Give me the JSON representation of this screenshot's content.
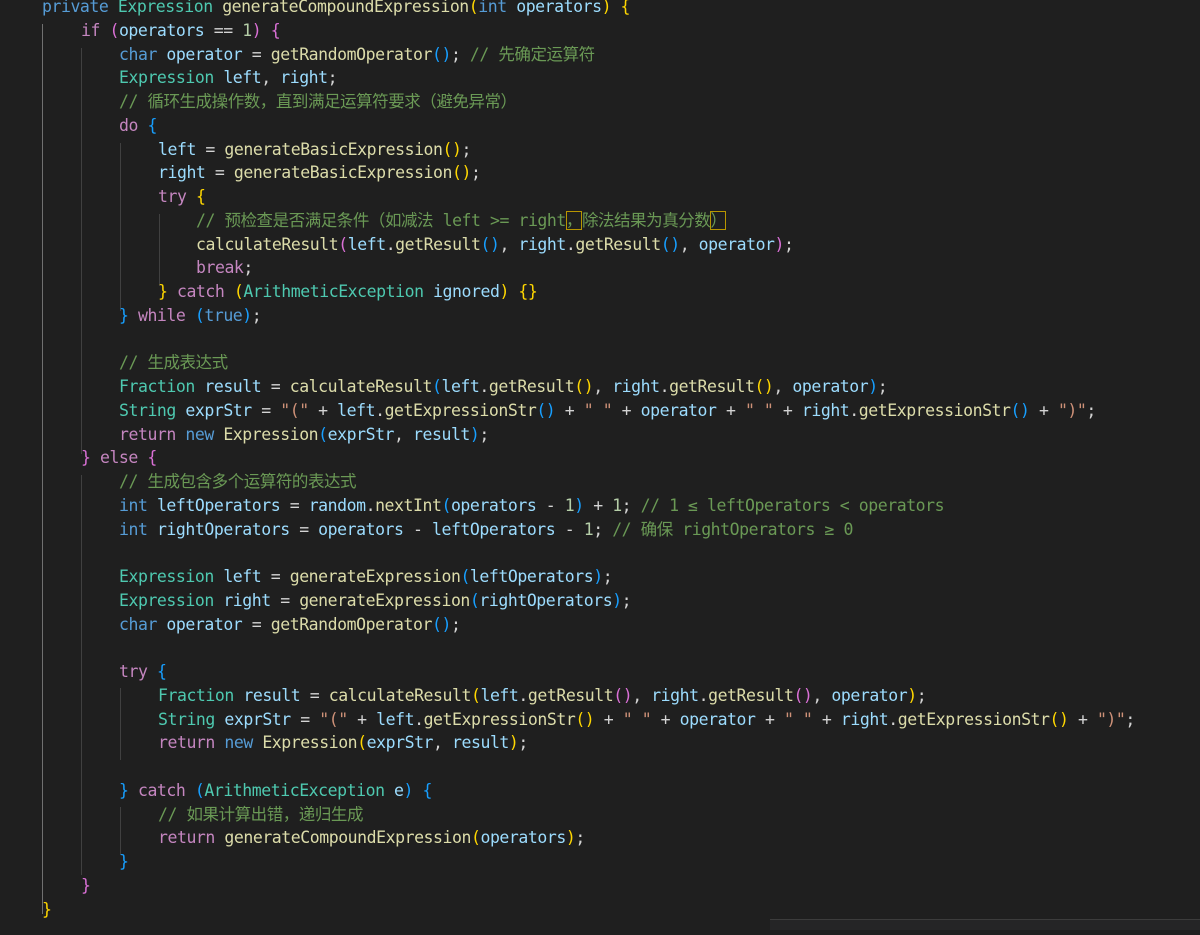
{
  "colors": {
    "background": "#1f1f1f",
    "keyword": "#569cd6",
    "control": "#c586c0",
    "type": "#4ec9b0",
    "function": "#dcdcaa",
    "variable": "#9cdcfe",
    "number": "#b5cea8",
    "string": "#ce9178",
    "comment": "#6a9955"
  },
  "lines": [
    [
      [
        "kw",
        "private "
      ],
      [
        "typ",
        "Expression "
      ],
      [
        "fn",
        "generateCompoundExpression"
      ],
      [
        "b1",
        "("
      ],
      [
        "kw",
        "int "
      ],
      [
        "var",
        "operators"
      ],
      [
        "b1",
        ")"
      ],
      [
        "op",
        " "
      ],
      [
        "b1",
        "{"
      ]
    ],
    [
      [
        "ctl",
        "if "
      ],
      [
        "b2",
        "("
      ],
      [
        "var",
        "operators"
      ],
      [
        "op",
        " == "
      ],
      [
        "num",
        "1"
      ],
      [
        "b2",
        ")"
      ],
      [
        "op",
        " "
      ],
      [
        "b2",
        "{"
      ]
    ],
    [
      [
        "kw",
        "char "
      ],
      [
        "var",
        "operator"
      ],
      [
        "op",
        " = "
      ],
      [
        "fn",
        "getRandomOperator"
      ],
      [
        "b3",
        "()"
      ],
      [
        "op",
        "; "
      ],
      [
        "cmt",
        "// 先确定运算符"
      ]
    ],
    [
      [
        "typ",
        "Expression "
      ],
      [
        "var",
        "left"
      ],
      [
        "op",
        ", "
      ],
      [
        "var",
        "right"
      ],
      [
        "op",
        ";"
      ]
    ],
    [
      [
        "cmt",
        "// 循环生成操作数，直到满足运算符要求（避免异常）"
      ]
    ],
    [
      [
        "ctl",
        "do "
      ],
      [
        "b3",
        "{"
      ]
    ],
    [
      [
        "var",
        "left"
      ],
      [
        "op",
        " = "
      ],
      [
        "fn",
        "generateBasicExpression"
      ],
      [
        "b1",
        "()"
      ],
      [
        "op",
        ";"
      ]
    ],
    [
      [
        "var",
        "right"
      ],
      [
        "op",
        " = "
      ],
      [
        "fn",
        "generateBasicExpression"
      ],
      [
        "b1",
        "()"
      ],
      [
        "op",
        ";"
      ]
    ],
    [
      [
        "ctl",
        "try "
      ],
      [
        "b1",
        "{"
      ]
    ],
    [
      [
        "cmt",
        "// 预检查是否满足条件（如减法 left >= right"
      ],
      [
        "cmt hl",
        "，"
      ],
      [
        "cmt",
        "除法结果为真分数"
      ],
      [
        "cmt hl",
        "）"
      ]
    ],
    [
      [
        "fn",
        "calculateResult"
      ],
      [
        "b2",
        "("
      ],
      [
        "var",
        "left"
      ],
      [
        "op",
        "."
      ],
      [
        "fn",
        "getResult"
      ],
      [
        "b3",
        "()"
      ],
      [
        "op",
        ", "
      ],
      [
        "var",
        "right"
      ],
      [
        "op",
        "."
      ],
      [
        "fn",
        "getResult"
      ],
      [
        "b3",
        "()"
      ],
      [
        "op",
        ", "
      ],
      [
        "var",
        "operator"
      ],
      [
        "b2",
        ")"
      ],
      [
        "op",
        ";"
      ]
    ],
    [
      [
        "ctl",
        "break"
      ],
      [
        "op",
        ";"
      ]
    ],
    [
      [
        "b1",
        "}"
      ],
      [
        "op",
        " "
      ],
      [
        "ctl",
        "catch "
      ],
      [
        "b1",
        "("
      ],
      [
        "typ",
        "ArithmeticException "
      ],
      [
        "var",
        "ignored"
      ],
      [
        "b1",
        ")"
      ],
      [
        "op",
        " "
      ],
      [
        "b1",
        "{}"
      ]
    ],
    [
      [
        "b3",
        "}"
      ],
      [
        "op",
        " "
      ],
      [
        "ctl",
        "while "
      ],
      [
        "b3",
        "("
      ],
      [
        "kw",
        "true"
      ],
      [
        "b3",
        ")"
      ],
      [
        "op",
        ";"
      ]
    ],
    [],
    [
      [
        "cmt",
        "// 生成表达式"
      ]
    ],
    [
      [
        "typ",
        "Fraction "
      ],
      [
        "var",
        "result"
      ],
      [
        "op",
        " = "
      ],
      [
        "fn",
        "calculateResult"
      ],
      [
        "b3",
        "("
      ],
      [
        "var",
        "left"
      ],
      [
        "op",
        "."
      ],
      [
        "fn",
        "getResult"
      ],
      [
        "b1",
        "()"
      ],
      [
        "op",
        ", "
      ],
      [
        "var",
        "right"
      ],
      [
        "op",
        "."
      ],
      [
        "fn",
        "getResult"
      ],
      [
        "b1",
        "()"
      ],
      [
        "op",
        ", "
      ],
      [
        "var",
        "operator"
      ],
      [
        "b3",
        ")"
      ],
      [
        "op",
        ";"
      ]
    ],
    [
      [
        "typ",
        "String "
      ],
      [
        "var",
        "exprStr"
      ],
      [
        "op",
        " = "
      ],
      [
        "str",
        "\"(\""
      ],
      [
        "op",
        " + "
      ],
      [
        "var",
        "left"
      ],
      [
        "op",
        "."
      ],
      [
        "fn",
        "getExpressionStr"
      ],
      [
        "b3",
        "()"
      ],
      [
        "op",
        " + "
      ],
      [
        "str",
        "\" \""
      ],
      [
        "op",
        " + "
      ],
      [
        "var",
        "operator"
      ],
      [
        "op",
        " + "
      ],
      [
        "str",
        "\" \""
      ],
      [
        "op",
        " + "
      ],
      [
        "var",
        "right"
      ],
      [
        "op",
        "."
      ],
      [
        "fn",
        "getExpressionStr"
      ],
      [
        "b3",
        "()"
      ],
      [
        "op",
        " + "
      ],
      [
        "str",
        "\")\""
      ],
      [
        "op",
        ";"
      ]
    ],
    [
      [
        "ctl",
        "return "
      ],
      [
        "kw",
        "new "
      ],
      [
        "fn",
        "Expression"
      ],
      [
        "b3",
        "("
      ],
      [
        "var",
        "exprStr"
      ],
      [
        "op",
        ", "
      ],
      [
        "var",
        "result"
      ],
      [
        "b3",
        ")"
      ],
      [
        "op",
        ";"
      ]
    ],
    [
      [
        "b2",
        "}"
      ],
      [
        "op",
        " "
      ],
      [
        "ctl",
        "else "
      ],
      [
        "b2",
        "{"
      ]
    ],
    [
      [
        "cmt",
        "// 生成包含多个运算符的表达式"
      ]
    ],
    [
      [
        "kw",
        "int "
      ],
      [
        "var",
        "leftOperators"
      ],
      [
        "op",
        " = "
      ],
      [
        "var",
        "random"
      ],
      [
        "op",
        "."
      ],
      [
        "fn",
        "nextInt"
      ],
      [
        "b3",
        "("
      ],
      [
        "var",
        "operators"
      ],
      [
        "op",
        " - "
      ],
      [
        "num",
        "1"
      ],
      [
        "b3",
        ")"
      ],
      [
        "op",
        " + "
      ],
      [
        "num",
        "1"
      ],
      [
        "op",
        "; "
      ],
      [
        "cmt",
        "// 1 ≤ leftOperators < operators"
      ]
    ],
    [
      [
        "kw",
        "int "
      ],
      [
        "var",
        "rightOperators"
      ],
      [
        "op",
        " = "
      ],
      [
        "var",
        "operators"
      ],
      [
        "op",
        " - "
      ],
      [
        "var",
        "leftOperators"
      ],
      [
        "op",
        " - "
      ],
      [
        "num",
        "1"
      ],
      [
        "op",
        "; "
      ],
      [
        "cmt",
        "// 确保 rightOperators ≥ 0"
      ]
    ],
    [],
    [
      [
        "typ",
        "Expression "
      ],
      [
        "var",
        "left"
      ],
      [
        "op",
        " = "
      ],
      [
        "fn",
        "generateExpression"
      ],
      [
        "b3",
        "("
      ],
      [
        "var",
        "leftOperators"
      ],
      [
        "b3",
        ")"
      ],
      [
        "op",
        ";"
      ]
    ],
    [
      [
        "typ",
        "Expression "
      ],
      [
        "var",
        "right"
      ],
      [
        "op",
        " = "
      ],
      [
        "fn",
        "generateExpression"
      ],
      [
        "b3",
        "("
      ],
      [
        "var",
        "rightOperators"
      ],
      [
        "b3",
        ")"
      ],
      [
        "op",
        ";"
      ]
    ],
    [
      [
        "kw",
        "char "
      ],
      [
        "var",
        "operator"
      ],
      [
        "op",
        " = "
      ],
      [
        "fn",
        "getRandomOperator"
      ],
      [
        "b3",
        "()"
      ],
      [
        "op",
        ";"
      ]
    ],
    [],
    [
      [
        "ctl",
        "try "
      ],
      [
        "b3",
        "{"
      ]
    ],
    [
      [
        "typ",
        "Fraction "
      ],
      [
        "var",
        "result"
      ],
      [
        "op",
        " = "
      ],
      [
        "fn",
        "calculateResult"
      ],
      [
        "b1",
        "("
      ],
      [
        "var",
        "left"
      ],
      [
        "op",
        "."
      ],
      [
        "fn",
        "getResult"
      ],
      [
        "b2",
        "()"
      ],
      [
        "op",
        ", "
      ],
      [
        "var",
        "right"
      ],
      [
        "op",
        "."
      ],
      [
        "fn",
        "getResult"
      ],
      [
        "b2",
        "()"
      ],
      [
        "op",
        ", "
      ],
      [
        "var",
        "operator"
      ],
      [
        "b1",
        ")"
      ],
      [
        "op",
        ";"
      ]
    ],
    [
      [
        "typ",
        "String "
      ],
      [
        "var",
        "exprStr"
      ],
      [
        "op",
        " = "
      ],
      [
        "str",
        "\"(\""
      ],
      [
        "op",
        " + "
      ],
      [
        "var",
        "left"
      ],
      [
        "op",
        "."
      ],
      [
        "fn",
        "getExpressionStr"
      ],
      [
        "b1",
        "()"
      ],
      [
        "op",
        " + "
      ],
      [
        "str",
        "\" \""
      ],
      [
        "op",
        " + "
      ],
      [
        "var",
        "operator"
      ],
      [
        "op",
        " + "
      ],
      [
        "str",
        "\" \""
      ],
      [
        "op",
        " + "
      ],
      [
        "var",
        "right"
      ],
      [
        "op",
        "."
      ],
      [
        "fn",
        "getExpressionStr"
      ],
      [
        "b1",
        "()"
      ],
      [
        "op",
        " + "
      ],
      [
        "str",
        "\")\""
      ],
      [
        "op",
        ";"
      ]
    ],
    [
      [
        "ctl",
        "return "
      ],
      [
        "kw",
        "new "
      ],
      [
        "fn",
        "Expression"
      ],
      [
        "b1",
        "("
      ],
      [
        "var",
        "exprStr"
      ],
      [
        "op",
        ", "
      ],
      [
        "var",
        "result"
      ],
      [
        "b1",
        ")"
      ],
      [
        "op",
        ";"
      ]
    ],
    [],
    [
      [
        "b3",
        "}"
      ],
      [
        "op",
        " "
      ],
      [
        "ctl",
        "catch "
      ],
      [
        "b3",
        "("
      ],
      [
        "typ",
        "ArithmeticException "
      ],
      [
        "var",
        "e"
      ],
      [
        "b3",
        ")"
      ],
      [
        "op",
        " "
      ],
      [
        "b3",
        "{"
      ]
    ],
    [
      [
        "cmt",
        "// 如果计算出错，递归生成"
      ]
    ],
    [
      [
        "ctl",
        "return "
      ],
      [
        "fn",
        "generateCompoundExpression"
      ],
      [
        "b1",
        "("
      ],
      [
        "var",
        "operators"
      ],
      [
        "b1",
        ")"
      ],
      [
        "op",
        ";"
      ]
    ],
    [
      [
        "b3",
        "}"
      ]
    ],
    [
      [
        "b2",
        "}"
      ]
    ],
    [
      [
        "b1",
        "}"
      ]
    ]
  ]
}
